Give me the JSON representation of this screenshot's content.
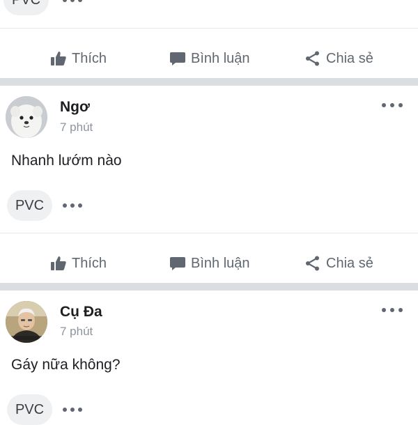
{
  "top_partial_post": {
    "reaction_label": "PVC"
  },
  "actions": {
    "like_label": "Thích",
    "comment_label": "Bình luận",
    "share_label": "Chia sẻ"
  },
  "posts": [
    {
      "author": "Ngơ",
      "time": "7 phút",
      "text": "Nhanh lướm nào",
      "reaction_label": "PVC",
      "avatar_icon": "puppy-avatar"
    },
    {
      "author": "Cụ Đa",
      "time": "7 phút",
      "text": "Gáy nữa không?",
      "reaction_label": "PVC",
      "avatar_icon": "old-man-avatar"
    }
  ],
  "colors": {
    "text_primary": "#1c1e21",
    "text_secondary": "#606770",
    "separator": "#dadde1",
    "pill_bg": "#eff0f2"
  }
}
